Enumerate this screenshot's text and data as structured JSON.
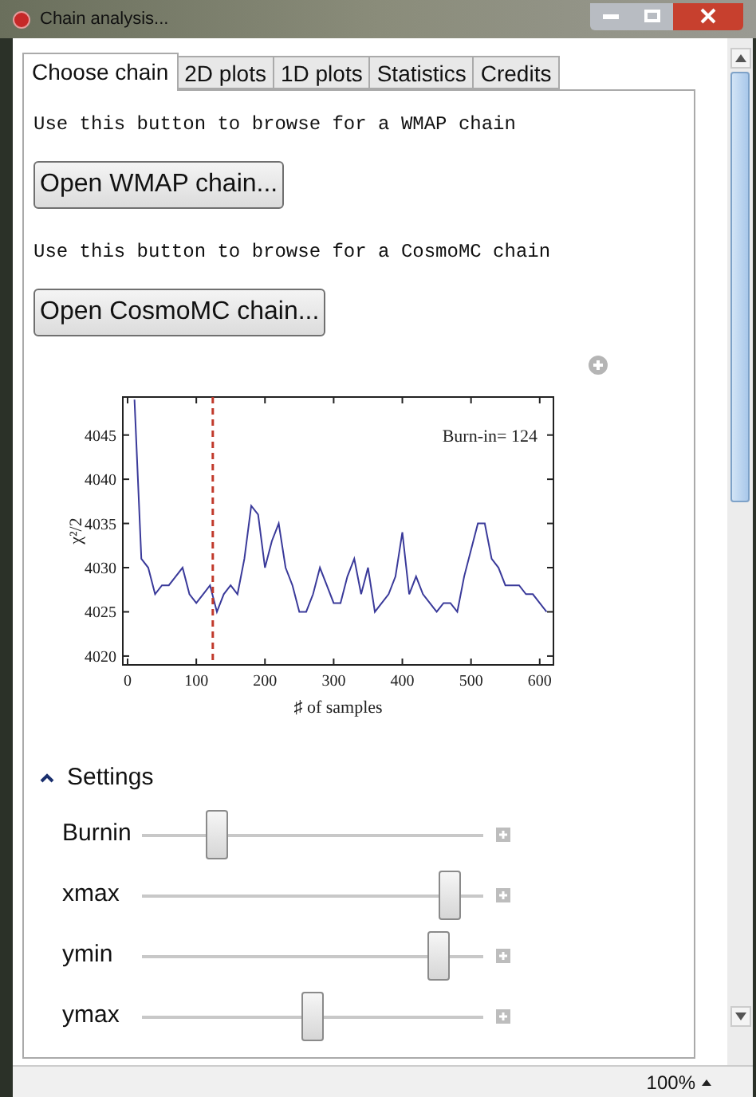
{
  "window": {
    "title": "Chain analysis..."
  },
  "tabs": [
    {
      "label": "Choose chain",
      "selected": true
    },
    {
      "label": "2D plots",
      "selected": false
    },
    {
      "label": "1D plots",
      "selected": false
    },
    {
      "label": "Statistics",
      "selected": false
    },
    {
      "label": "Credits",
      "selected": false
    }
  ],
  "loaders": [
    {
      "hint": "Use this button to browse for a WMAP chain",
      "button": "Open WMAP chain..."
    },
    {
      "hint": "Use this button to browse for a CosmoMC chain",
      "button": "Open CosmoMC chain..."
    }
  ],
  "chart": {
    "chart_data": {
      "type": "line",
      "xlabel": "♯ of samples",
      "ylabel": "χ²/2",
      "xlim": [
        -7,
        620
      ],
      "ylim": [
        4019,
        4049.3
      ],
      "xticks": [
        0,
        100,
        200,
        300,
        400,
        500,
        600
      ],
      "yticks": [
        4020,
        4025,
        4030,
        4035,
        4040,
        4045
      ],
      "x": [
        10,
        20,
        30,
        40,
        50,
        60,
        70,
        80,
        90,
        100,
        110,
        120,
        130,
        140,
        150,
        160,
        170,
        180,
        190,
        200,
        210,
        220,
        230,
        240,
        250,
        260,
        270,
        280,
        290,
        300,
        310,
        320,
        330,
        340,
        350,
        360,
        370,
        380,
        390,
        400,
        410,
        420,
        430,
        440,
        450,
        460,
        470,
        480,
        490,
        500,
        510,
        520,
        530,
        540,
        550,
        560,
        570,
        580,
        590,
        600,
        610
      ],
      "series": [
        {
          "color": "#3a3a9a",
          "values": [
            4049,
            4031,
            4030,
            4027,
            4028,
            4028,
            4029,
            4030,
            4027,
            4026,
            4027,
            4028,
            4025,
            4027,
            4028,
            4027,
            4031,
            4037,
            4036,
            4030,
            4033,
            4035,
            4030,
            4028,
            4025,
            4025,
            4027,
            4030,
            4028,
            4026,
            4026,
            4029,
            4031,
            4027,
            4030,
            4025,
            4026,
            4027,
            4029,
            4034,
            4027,
            4029,
            4027,
            4026,
            4025,
            4026,
            4026,
            4025,
            4029,
            4032,
            4035,
            4035,
            4031,
            4030,
            4028,
            4028,
            4028,
            4027,
            4027,
            4026,
            4025
          ]
        }
      ],
      "ref_lines": [
        {
          "axis": "x",
          "value": 124,
          "color": "#c0392b"
        }
      ],
      "annotations": [
        {
          "text": "Burn-in= 124"
        }
      ]
    }
  },
  "settings": {
    "label": "Settings",
    "expanded": true,
    "sliders": [
      {
        "label": "Burnin",
        "level": 0.22
      },
      {
        "label": "xmax",
        "level": 0.9
      },
      {
        "label": "ymin",
        "level": 0.87
      },
      {
        "label": "ymax",
        "level": 0.5
      }
    ]
  },
  "status_bar": {
    "zoom": "100%"
  }
}
